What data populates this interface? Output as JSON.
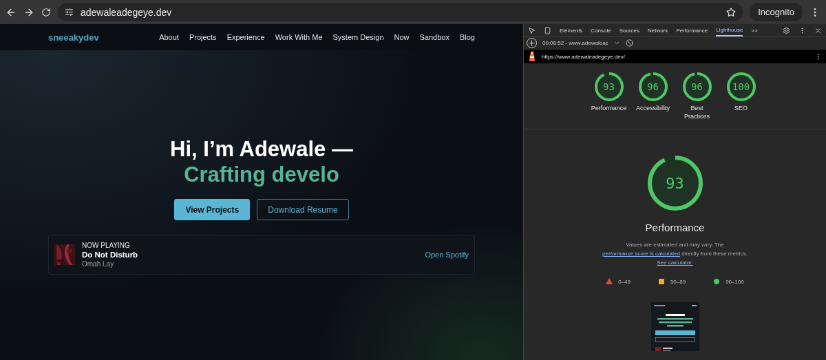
{
  "browser": {
    "url": "adewaleadegeye.dev",
    "profile": "Incognito"
  },
  "site": {
    "logo": "sneeakydev",
    "nav": [
      "About",
      "Projects",
      "Experience",
      "Work With Me",
      "System Design",
      "Now",
      "Sandbox",
      "Blog"
    ],
    "hero": {
      "title": "Hi, I’m Adewale —",
      "subtitle": "Crafting develo"
    },
    "buttons": [
      {
        "label": "View Projects",
        "kind": "primary"
      },
      {
        "label": "Download Resume",
        "kind": "outline"
      }
    ],
    "now_playing": {
      "label": "NOW PLAYING",
      "track": "Do Not Disturb",
      "artist": "Omah Lay",
      "link": "Open Spotify"
    }
  },
  "devtools": {
    "tabs": [
      {
        "label": "Elements",
        "selected": false
      },
      {
        "label": "Console",
        "selected": false
      },
      {
        "label": "Sources",
        "selected": false
      },
      {
        "label": "Network",
        "selected": false
      },
      {
        "label": "Performance",
        "selected": false
      },
      {
        "label": "Lighthouse",
        "selected": true
      }
    ],
    "more": ">>",
    "report_select": "00:06:52 - www.adewaleac",
    "report_url": "https://www.adewaleadegeye.dev/",
    "scores": [
      {
        "value": "93",
        "label": "Performance",
        "level": 0.93
      },
      {
        "value": "96",
        "label": "Accessibility",
        "level": 0.96
      },
      {
        "value": "96",
        "label": "Best Practices",
        "level": 0.96
      },
      {
        "value": "100",
        "label": "SEO",
        "level": 1
      }
    ],
    "main_score": {
      "value": "93",
      "label": "Performance",
      "level": 0.93
    },
    "description": "Values are estimated and may vary. The ",
    "link_1": "performance score is calculated",
    "description_2": " directly from these metrics. ",
    "link_2": "See calculator.",
    "legend": [
      {
        "kind": "triangle",
        "label": "0–49",
        "color": "#e5483b"
      },
      {
        "kind": "square",
        "label": "50–89",
        "color": "#f0a83a"
      },
      {
        "kind": "circle",
        "label": "90–100",
        "color": "#4fc765"
      }
    ]
  }
}
